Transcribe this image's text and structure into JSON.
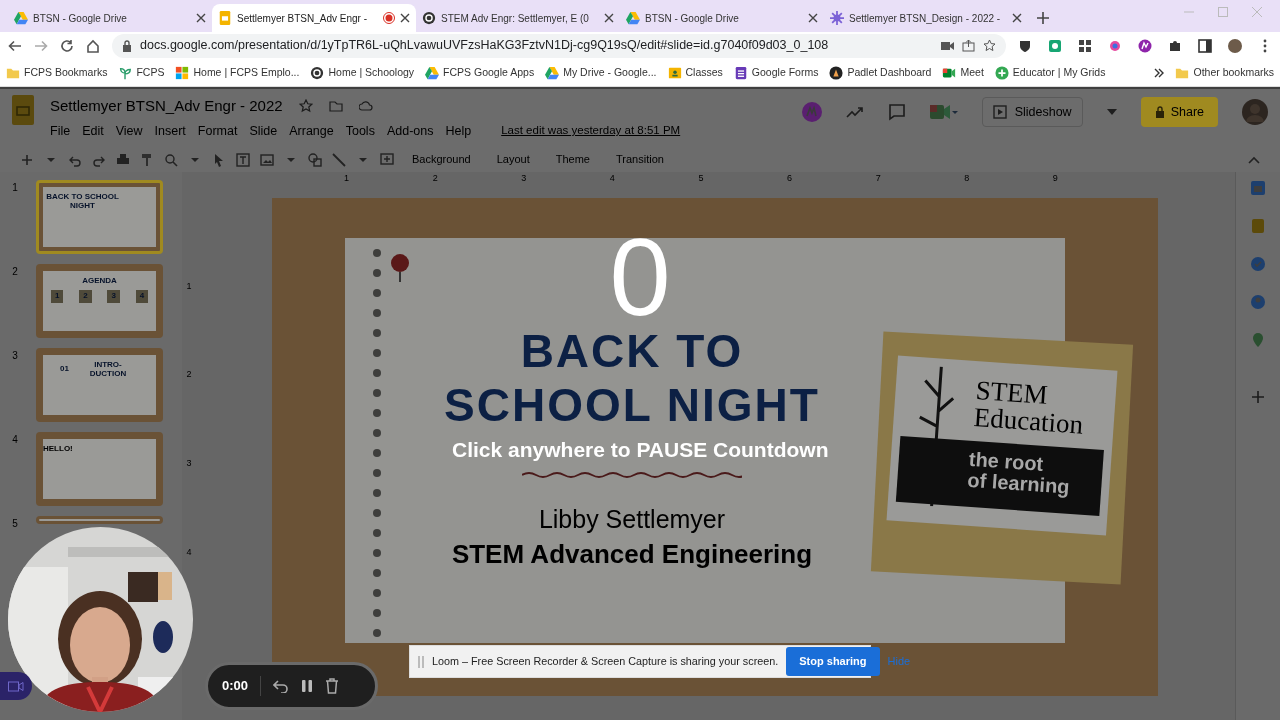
{
  "browser": {
    "tabs": [
      {
        "title": "BTSN - Google Drive",
        "kind": "drive",
        "selected": false,
        "recording": false
      },
      {
        "title": "Settlemyer BTSN_Adv Engr -",
        "kind": "slides",
        "selected": true,
        "recording": true
      },
      {
        "title": "STEM Adv Engr: Settlemyer, E (0",
        "kind": "schoology",
        "selected": false,
        "recording": false
      },
      {
        "title": "BTSN - Google Drive",
        "kind": "drive",
        "selected": false,
        "recording": false
      },
      {
        "title": "Settlemyer BTSN_Design - 2022 -",
        "kind": "burst",
        "selected": false,
        "recording": false
      }
    ],
    "url": "docs.google.com/presentation/d/1yTpTR6L-uQhLvawuUVFzsHaKG3FztvN1Dj-cg9Q19sQ/edit#slide=id.g7040f09d03_0_108",
    "bookmarks": [
      {
        "label": "FCPS Bookmarks",
        "kind": "folder"
      },
      {
        "label": "FCPS",
        "kind": "sprout"
      },
      {
        "label": "Home | FCPS Emplo...",
        "kind": "windows"
      },
      {
        "label": "Home | Schoology",
        "kind": "schoology"
      },
      {
        "label": "FCPS Google Apps",
        "kind": "drive"
      },
      {
        "label": "My Drive - Google...",
        "kind": "drive"
      },
      {
        "label": "Classes",
        "kind": "classroom"
      },
      {
        "label": "Google Forms",
        "kind": "forms"
      },
      {
        "label": "Padlet Dashboard",
        "kind": "padlet"
      },
      {
        "label": "Meet",
        "kind": "meet"
      },
      {
        "label": "Educator | My Grids",
        "kind": "plus"
      }
    ],
    "other_bookmarks": "Other bookmarks"
  },
  "doc": {
    "title": "Settlemyer BTSN_Adv Engr - 2022",
    "menu": [
      "File",
      "Edit",
      "View",
      "Insert",
      "Format",
      "Slide",
      "Arrange",
      "Tools",
      "Add-ons",
      "Help"
    ],
    "last_edit": "Last edit was yesterday at 8:51 PM",
    "toolbar_buttons": [
      "Background",
      "Layout",
      "Theme",
      "Transition"
    ],
    "slideshow": "Slideshow",
    "share": "Share"
  },
  "ruler_h": [
    "1",
    "2",
    "3",
    "4",
    "5",
    "6",
    "7",
    "8",
    "9"
  ],
  "ruler_v": [
    "1",
    "2",
    "3",
    "4"
  ],
  "thumbnails": [
    {
      "number": "1",
      "selected": true,
      "kind": "title",
      "title": "BACK TO SCHOOL NIGHT"
    },
    {
      "number": "2",
      "selected": false,
      "kind": "agenda",
      "title": "AGENDA",
      "items": [
        "1",
        "2",
        "3",
        "4"
      ]
    },
    {
      "number": "3",
      "selected": false,
      "kind": "section",
      "badge": "01",
      "title": "INTRO-DUCTION"
    },
    {
      "number": "4",
      "selected": false,
      "kind": "hello",
      "title": "HELLO!"
    },
    {
      "number": "5",
      "selected": false,
      "kind": "blank"
    }
  ],
  "slide": {
    "title_lines": [
      "BACK TO",
      "SCHOOL NIGHT"
    ],
    "name": "Libby Settlemyer",
    "course": "STEM Advanced Engineering",
    "logo": {
      "top": [
        "STEM",
        "Education"
      ],
      "bottom": [
        "the root",
        "of learning"
      ]
    }
  },
  "countdown": {
    "number": "0",
    "message": "Click anywhere to PAUSE Countdown"
  },
  "camera": {
    "kind": "picture"
  },
  "loom": {
    "timer": "0:00",
    "banner": "Loom – Free Screen Recorder & Screen Capture is sharing your screen.",
    "stop": "Stop sharing",
    "hide": "Hide"
  }
}
